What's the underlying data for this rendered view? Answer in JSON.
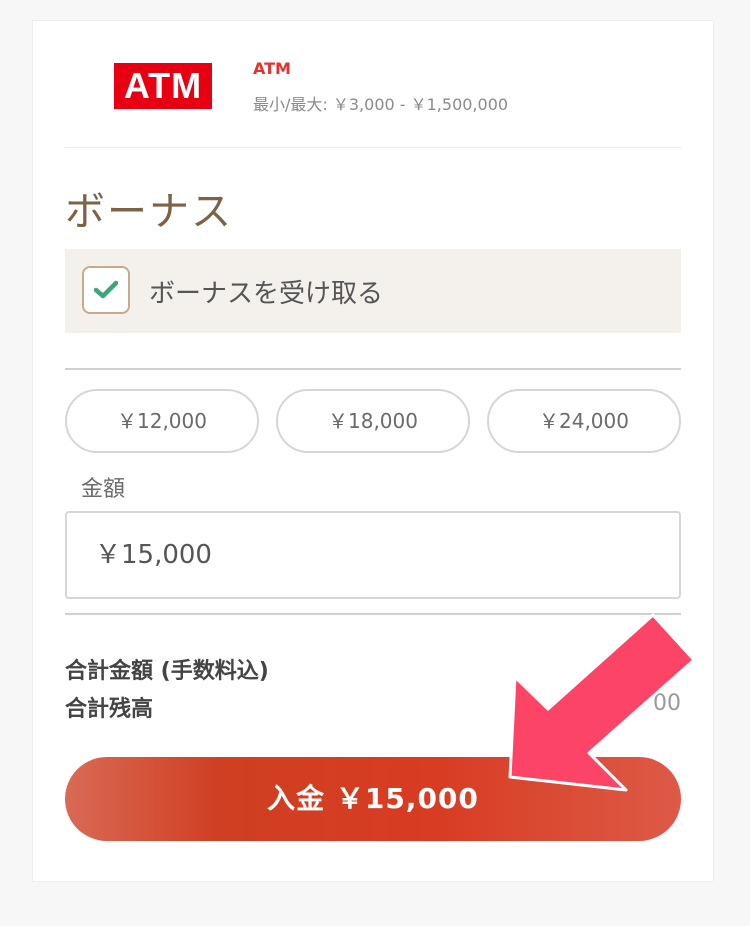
{
  "payment_method": {
    "logo_text": "ATM",
    "name": "ATM",
    "limits": "最小/最大: ￥3,000 - ￥1,500,000",
    "brand_color": "#e60012"
  },
  "bonus": {
    "title": "ボーナス",
    "checkbox_label": "ボーナスを受け取る",
    "checked": true,
    "check_icon": "check-icon"
  },
  "presets": [
    "￥12,000",
    "￥18,000",
    "￥24,000"
  ],
  "amount": {
    "label": "金額",
    "value": "￥15,000"
  },
  "summary": {
    "total_label": "合計金額 (手数料込)",
    "total_value": "￥",
    "balance_label": "合計残高",
    "balance_value": "00"
  },
  "deposit_button": {
    "label": "入金 ￥15,000",
    "accent_color": "#d83c22"
  },
  "overlay": {
    "arrow_icon": "pointer-arrow-icon",
    "arrow_color": "#fc4466"
  }
}
